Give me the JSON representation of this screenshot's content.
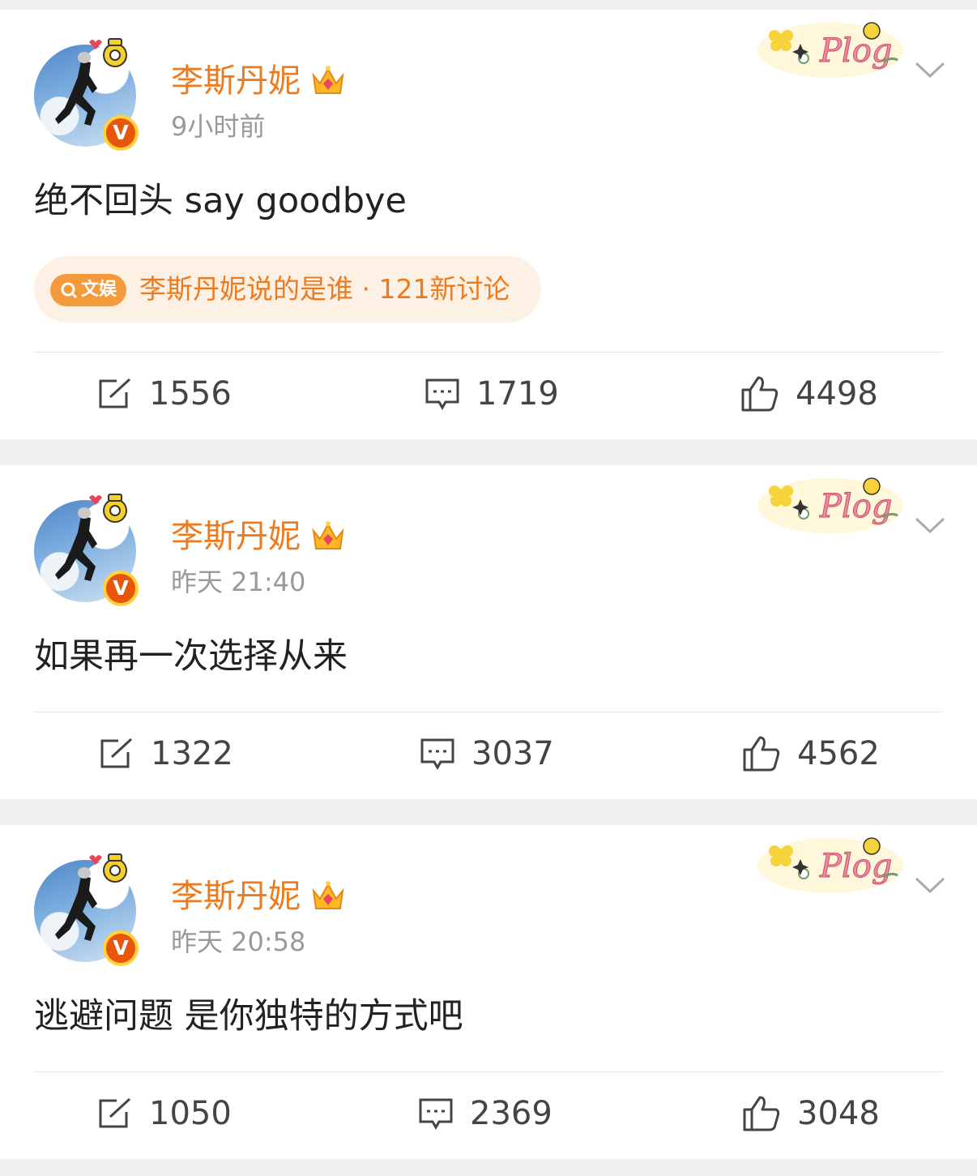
{
  "posts": [
    {
      "author": "李斯丹妮",
      "time": "9小时前",
      "text": "绝不回头 say goodbye",
      "topic": {
        "tag": "文娱",
        "text": "李斯丹妮说的是谁 · 121新讨论"
      },
      "actions": {
        "reposts": "1556",
        "comments": "1719",
        "likes": "4498"
      }
    },
    {
      "author": "李斯丹妮",
      "time": "昨天 21:40",
      "text": "如果再一次选择从来",
      "actions": {
        "reposts": "1322",
        "comments": "3037",
        "likes": "4562"
      }
    },
    {
      "author": "李斯丹妮",
      "time": "昨天 20:58",
      "text": "逃避问题 是你独特的方式吧",
      "actions": {
        "reposts": "1050",
        "comments": "2369",
        "likes": "3048"
      }
    }
  ],
  "badge": {
    "verified": "V"
  },
  "decoration": {
    "plog": "Plog"
  },
  "colors": {
    "name": "#ee7a1e",
    "badge": "#e8560c",
    "topic_bg": "#fdf1e6",
    "topic_tag": "#f59a3c"
  },
  "icons": [
    "repost-icon",
    "comment-icon",
    "like-icon",
    "chevron-down-icon",
    "crown-icon",
    "verified-badge-icon",
    "search-icon"
  ]
}
